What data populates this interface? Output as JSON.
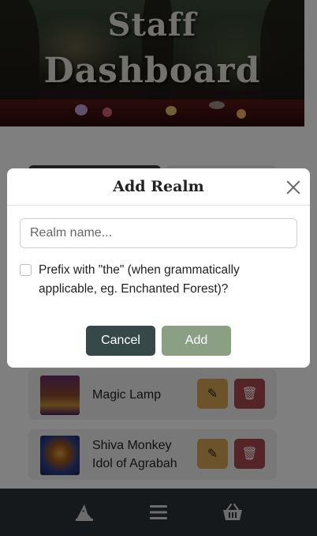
{
  "banner": {
    "title_line1": "Staff",
    "title_line2": "Dashboard"
  },
  "list": {
    "items": [
      {
        "name": "Magic Lamp",
        "image": "magic-lamp-image"
      },
      {
        "name": "Shiva Monkey Idol of Agrabah",
        "image": "monkey-idol-image"
      }
    ]
  },
  "modal": {
    "title": "Add Realm",
    "realm_input": {
      "value": "",
      "placeholder": "Realm name..."
    },
    "prefix_checkbox": {
      "checked": false,
      "label": "Prefix with \"the\" (when grammatically applicable, eg. Enchanted Forest)?"
    },
    "cancel_label": "Cancel",
    "add_label": "Add"
  },
  "bottom_nav": {
    "items": [
      {
        "icon": "wizard-hat-icon"
      },
      {
        "icon": "menu-icon"
      },
      {
        "icon": "basket-icon"
      }
    ]
  },
  "colors": {
    "cancel": "#374849",
    "add": "#8a9f84",
    "edit": "#d9a652",
    "delete": "#a8484f",
    "nav_bg": "#2c3338"
  }
}
